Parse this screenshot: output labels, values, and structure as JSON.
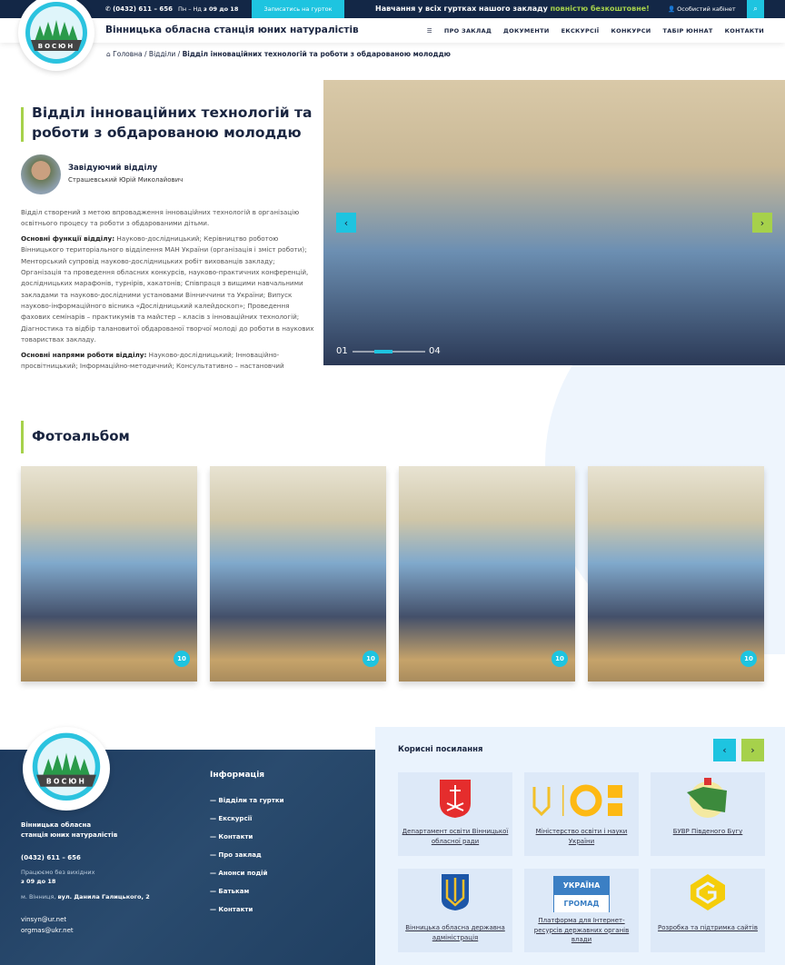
{
  "topbar": {
    "phone": "(0432) 611 – 656",
    "hours_prefix": "Пн – Нд",
    "hours": "з 09 до 18",
    "signup": "Записатись на гурток",
    "announcement": "Навчання у всіх гуртках нашого закладу",
    "announcement_highlight": "повністю безкоштовне!",
    "cabinet": "Особистий кабінет",
    "highlight_color": "#a6d14b",
    "accent": "#1ec4e0"
  },
  "header": {
    "site_name": "Вінницька обласна станція юних натуралістів",
    "logo_text": "ВОСЮН",
    "nav": [
      "ПРО ЗАКЛАД",
      "ДОКУМЕНТИ",
      "ЕКСКУРСІЇ",
      "КОНКУРСИ",
      "ТАБІР ЮННАТ",
      "КОНТАКТИ"
    ]
  },
  "breadcrumb": [
    "Головна",
    "Відділи",
    "Відділ інноваційних технологій та роботи з обдарованою молоддю"
  ],
  "page": {
    "title": "Відділ інноваційних технологій та роботи з обдарованою молоддю",
    "head_role": "Завідуючий відділу",
    "head_name": "Страшевський Юрій Миколайович",
    "intro": "Відділ створений з метою впровадження  інноваційних технологій в організацію освітнього процесу та роботи  з  обдарованими дітьми.",
    "functions_label": "Основні функції відділу:",
    "functions": " Науково-дослідницький; Керівництво роботою Вінницького територіального відділення МАН України (організація і зміст роботи); Менторський супровід науково-дослідницьких робіт вихованців закладу; Організація та проведення   обласних    конкурсів, науково-практичних конференцій, дослідницьких   марафонів,  турнірів, хакатонів; Співпраця   з вищими навчальними   закладами  та науково-дослідними  установами  Вінниччини та України; Випуск науково-інформаційного  вісника «Дослідницький калейдоскоп»; Проведення  фахових семінарів – практикумів  та майстер – класів з   інноваційних технологій; Діагностика та відбір талановитої обдарованої  творчої молоді до роботи в наукових товариствах закладу.",
    "directions_label": "Основні напрями роботи відділу:",
    "directions": " Науково-дослідницький; Інноваційно-просвітницький; Інформаційно-методичний; Консультативно – настановчий"
  },
  "slider": {
    "current": "01",
    "total": "04",
    "progress": 0.25
  },
  "album": {
    "title": "Фотоальбом",
    "items": [
      {
        "count": "10"
      },
      {
        "count": "10"
      },
      {
        "count": "10"
      },
      {
        "count": "10"
      }
    ]
  },
  "footer": {
    "org_line1": "Вінницька обласна",
    "org_line2": "станція юних натуралістів",
    "phone": "(0432) 611 – 656",
    "work": "Працюємо без вихідних",
    "hours": "з 09 до 18",
    "city": "м. Вінниця,",
    "street": "вул. Данила Галицького, 2",
    "email1": "vinsyn@ur.net",
    "email2": "orgmas@ukr.net",
    "info_title": "Інформація",
    "info_links": [
      "— Відділи та гуртки",
      "— Екскурсії",
      "— Контакти",
      "— Про заклад",
      "— Анонси подій",
      "— Батькам",
      "— Контакти"
    ]
  },
  "useful": {
    "title": "Корисні посилання",
    "cards": [
      {
        "label": "Департамент освіти Вінницької обласної ради",
        "icon": "vinnytsia-coat-of-arms"
      },
      {
        "label": "Міністерство освіти і науки України",
        "icon": "mon-logo"
      },
      {
        "label": "БУВР Південого Бугу",
        "icon": "buvr-map-logo"
      },
      {
        "label": "Вінницька обласна державна адміністрація",
        "icon": "trident-coat-of-arms"
      },
      {
        "label": "Платформа для Інтернет-ресурсів державних органів влади",
        "icon": "ukraina-gromad-logo",
        "logo_top": "УКРАЇНА",
        "logo_bottom": "ГРОМАД"
      },
      {
        "label": "Розробка та підтримка сайтів",
        "icon": "g-logo"
      }
    ]
  }
}
